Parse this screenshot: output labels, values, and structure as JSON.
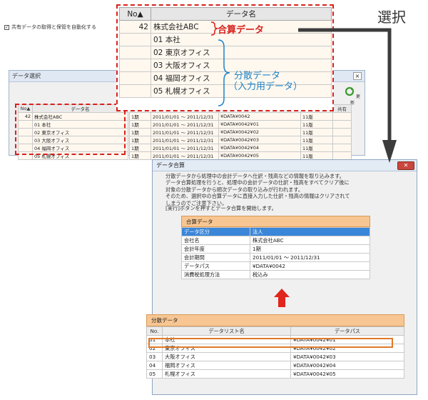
{
  "back_window": {
    "title": "データ選択",
    "checkbox_label": "共有データの取得と保管を自動化する",
    "update_label": "更新",
    "left_headers": [
      "No▲",
      "データ名"
    ],
    "left_rows": [
      {
        "no": "42",
        "name": "株式会社ABC"
      },
      {
        "no": "01",
        "name": "本社"
      },
      {
        "no": "02",
        "name": "東京オフィス"
      },
      {
        "no": "03",
        "name": "大阪オフィス"
      },
      {
        "no": "04",
        "name": "福岡オフィス"
      },
      {
        "no": "05",
        "name": "札幌オフィス"
      }
    ],
    "right_header_last": "共有",
    "right_rows": [
      {
        "term": "1期",
        "period": "2011/01/01 ～ 2011/12/31",
        "path": "¥DATA¥0042",
        "ver": "11版"
      },
      {
        "term": "1期",
        "period": "2011/01/01 ～ 2011/12/31",
        "path": "¥DATA¥0042¥01",
        "ver": "11版"
      },
      {
        "term": "1期",
        "period": "2011/01/01 ～ 2011/12/31",
        "path": "¥DATA¥0042¥02",
        "ver": "11版"
      },
      {
        "term": "1期",
        "period": "2011/01/01 ～ 2011/12/31",
        "path": "¥DATA¥0042¥03",
        "ver": "11版"
      },
      {
        "term": "1期",
        "period": "2011/01/01 ～ 2011/12/31",
        "path": "¥DATA¥0042¥04",
        "ver": "11版"
      },
      {
        "term": "1期",
        "period": "2011/01/01 ～ 2011/12/31",
        "path": "¥DATA¥0042¥05",
        "ver": "11版"
      }
    ]
  },
  "callout": {
    "headers": [
      "No▲",
      "データ名"
    ],
    "rows": [
      {
        "no": "42",
        "name": "株式会社ABC"
      },
      {
        "no": "",
        "name": "01 本社"
      },
      {
        "no": "",
        "name": "02 東京オフィス"
      },
      {
        "no": "",
        "name": "03 大阪オフィス"
      },
      {
        "no": "",
        "name": "04 福岡オフィス"
      },
      {
        "no": "",
        "name": "05 札幌オフィス"
      }
    ],
    "merge_label": "合算データ",
    "dist_label_1": "分散データ",
    "dist_label_2": "（入力用データ）",
    "select_label": "選択"
  },
  "merge_window": {
    "title": "データ合算",
    "close_label": "✕",
    "desc_lines": [
      "分散データから処理中の会計データへ仕訳・残高などの情報を取り込みます。",
      "データ合算処理を行うと、処理中の会計データの仕訳・残高をすべてクリア後に",
      "対象の分散データから順次データの取り込みが行われます。",
      "そのため、選択中の合算データに直接入力した仕訳・残高の情報はクリアされて",
      "しまうのでご注意下さい。"
    ],
    "desc_run": "[実行]ボタンを押すとデータ合算を開始します。",
    "merge_panel": {
      "title": "合算データ",
      "rows": [
        {
          "key": "データ区分",
          "value": "法人"
        },
        {
          "key": "会社名",
          "value": "株式会社ABC"
        },
        {
          "key": "会計年度",
          "value": "1期"
        },
        {
          "key": "会計期間",
          "value": "2011/01/01 ～ 2011/12/31"
        },
        {
          "key": "データパス",
          "value": "¥DATA¥0042"
        },
        {
          "key": "消費税処理方法",
          "value": "税込み"
        }
      ]
    },
    "dist_panel": {
      "title": "分散データ",
      "headers": [
        "No.",
        "データリスト名",
        "データパス"
      ],
      "rows": [
        {
          "no": "01",
          "name": "本社",
          "path": "¥DATA¥0042¥01"
        },
        {
          "no": "02",
          "name": "東京オフィス",
          "path": "¥DATA¥0042¥02"
        },
        {
          "no": "03",
          "name": "大阪オフィス",
          "path": "¥DATA¥0042¥03"
        },
        {
          "no": "04",
          "name": "福岡オフィス",
          "path": "¥DATA¥0042¥04"
        },
        {
          "no": "05",
          "name": "札幌オフィス",
          "path": "¥DATA¥0042¥05"
        }
      ]
    }
  },
  "colors": {
    "callout_border": "#d8211c",
    "dist_label": "#1d82c4",
    "selection_blue": "#3a86d8",
    "panel_header": "#f7c692",
    "highlight_row": "#e07a28"
  }
}
